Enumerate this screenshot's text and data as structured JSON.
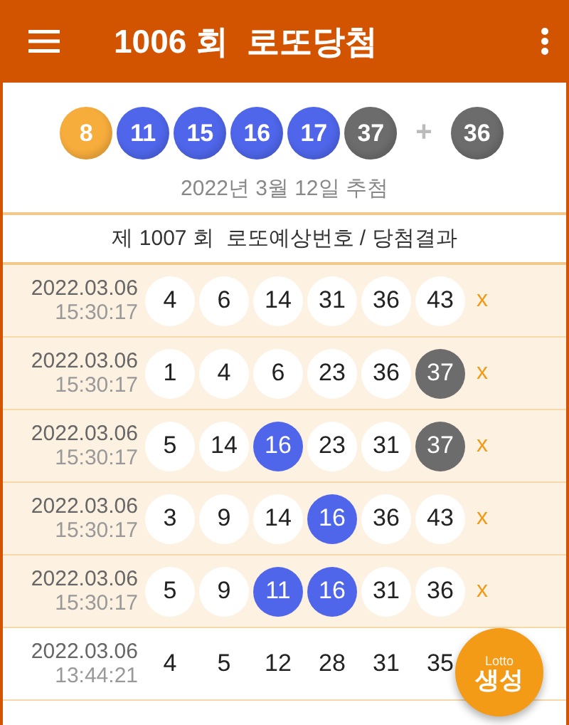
{
  "app_bar": {
    "title": "1006 회  로또당첨"
  },
  "winning_numbers": {
    "balls": [
      {
        "number": "8",
        "color": "#f7ad3c"
      },
      {
        "number": "11",
        "color": "#4f66ea"
      },
      {
        "number": "15",
        "color": "#4f66ea"
      },
      {
        "number": "16",
        "color": "#4f66ea"
      },
      {
        "number": "17",
        "color": "#4f66ea"
      },
      {
        "number": "37",
        "color": "#6c6c6c"
      }
    ],
    "plus": "+",
    "bonus": {
      "number": "36",
      "color": "#6c6c6c"
    },
    "draw_date": "2022년 3월 12일 추첨"
  },
  "list_header": "제 1007 회  로또예상번호 / 당첨결과",
  "rows": [
    {
      "date": "2022.03.06",
      "time": "15:30:17",
      "selected": true,
      "mark": "x",
      "numbers": [
        {
          "n": "4",
          "kind": "plain"
        },
        {
          "n": "6",
          "kind": "plain"
        },
        {
          "n": "14",
          "kind": "plain"
        },
        {
          "n": "31",
          "kind": "plain"
        },
        {
          "n": "36",
          "kind": "plain"
        },
        {
          "n": "43",
          "kind": "plain"
        }
      ]
    },
    {
      "date": "2022.03.06",
      "time": "15:30:17",
      "selected": true,
      "mark": "x",
      "numbers": [
        {
          "n": "1",
          "kind": "plain"
        },
        {
          "n": "4",
          "kind": "plain"
        },
        {
          "n": "6",
          "kind": "plain"
        },
        {
          "n": "23",
          "kind": "plain"
        },
        {
          "n": "36",
          "kind": "plain"
        },
        {
          "n": "37",
          "kind": "bonus"
        }
      ]
    },
    {
      "date": "2022.03.06",
      "time": "15:30:17",
      "selected": true,
      "mark": "x",
      "numbers": [
        {
          "n": "5",
          "kind": "plain"
        },
        {
          "n": "14",
          "kind": "plain"
        },
        {
          "n": "16",
          "kind": "match"
        },
        {
          "n": "23",
          "kind": "plain"
        },
        {
          "n": "31",
          "kind": "plain"
        },
        {
          "n": "37",
          "kind": "bonus"
        }
      ]
    },
    {
      "date": "2022.03.06",
      "time": "15:30:17",
      "selected": true,
      "mark": "x",
      "numbers": [
        {
          "n": "3",
          "kind": "plain"
        },
        {
          "n": "9",
          "kind": "plain"
        },
        {
          "n": "14",
          "kind": "plain"
        },
        {
          "n": "16",
          "kind": "match"
        },
        {
          "n": "36",
          "kind": "plain"
        },
        {
          "n": "43",
          "kind": "plain"
        }
      ]
    },
    {
      "date": "2022.03.06",
      "time": "15:30:17",
      "selected": true,
      "mark": "x",
      "numbers": [
        {
          "n": "5",
          "kind": "plain"
        },
        {
          "n": "9",
          "kind": "plain"
        },
        {
          "n": "11",
          "kind": "match"
        },
        {
          "n": "16",
          "kind": "match"
        },
        {
          "n": "31",
          "kind": "plain"
        },
        {
          "n": "36",
          "kind": "plain"
        }
      ]
    },
    {
      "date": "2022.03.06",
      "time": "13:44:21",
      "selected": false,
      "numbers": [
        {
          "n": "4",
          "kind": "plain"
        },
        {
          "n": "5",
          "kind": "plain"
        },
        {
          "n": "12",
          "kind": "plain"
        },
        {
          "n": "28",
          "kind": "plain"
        },
        {
          "n": "31",
          "kind": "plain"
        },
        {
          "n": "35",
          "kind": "plain"
        }
      ]
    }
  ],
  "fab": {
    "caption": "Lotto",
    "label": "생성"
  }
}
